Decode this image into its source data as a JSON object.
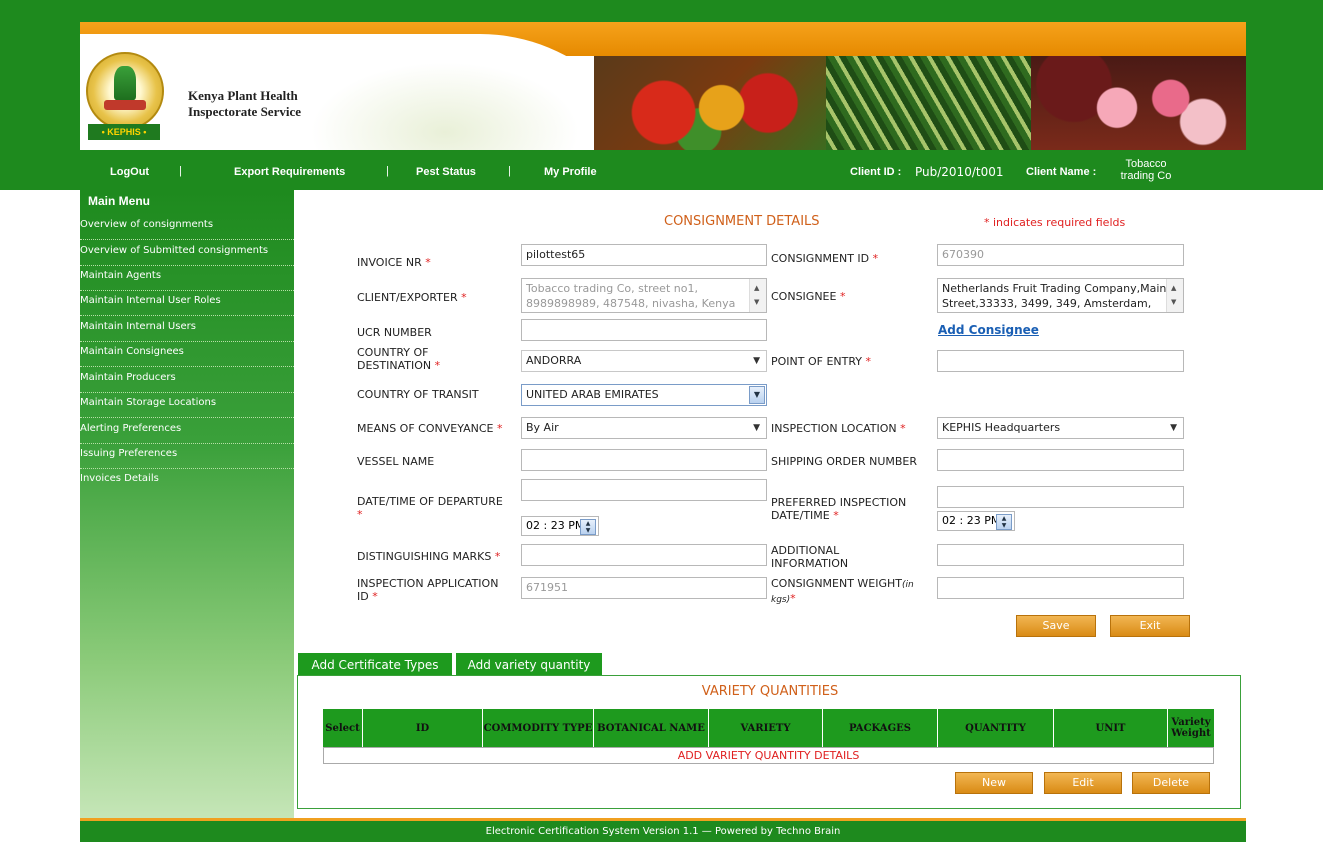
{
  "org": {
    "name_line1": "Kenya Plant Health",
    "name_line2": "Inspectorate Service",
    "logo_text": "• KEPHIS •"
  },
  "nav": {
    "items": [
      "LogOut",
      "Export Requirements",
      "Pest Status",
      "My Profile"
    ],
    "separator": "|",
    "client_id_label": "Client ID  :",
    "client_id_value": "Pub/2010/t001",
    "client_name_label": "Client Name  :",
    "client_name_value_line1": "Tobacco",
    "client_name_value_line2": "trading Co"
  },
  "sidebar": {
    "title": "Main Menu",
    "items": [
      "Overview of consignments",
      "Overview of Submitted consignments",
      "Maintain Agents",
      "Maintain Internal User Roles",
      "Maintain Internal Users",
      "Maintain Consignees",
      "Maintain Producers",
      "Maintain Storage Locations",
      "Alerting Preferences",
      "Issuing Preferences",
      "Invoices Details"
    ]
  },
  "form": {
    "title": "CONSIGNMENT DETAILS",
    "required_note": "* indicates required fields",
    "required_star": "*",
    "invoice_nr": {
      "label": "INVOICE NR",
      "value": "pilottest65"
    },
    "consignment_id": {
      "label": "CONSIGNMENT ID",
      "value": "670390"
    },
    "client_exporter": {
      "label": "CLIENT/EXPORTER",
      "value": "Tobacco trading Co, street no1, 8989898989, 487548, nivasha, Kenya"
    },
    "consignee": {
      "label": "CONSIGNEE",
      "value": "Netherlands Fruit Trading Company,Main Street,33333, 3499, 349, Amsterdam,"
    },
    "ucr_number": {
      "label": "UCR NUMBER",
      "value": ""
    },
    "add_consignee_link": "Add Consignee",
    "country_destination": {
      "label_line1": "COUNTRY OF",
      "label_line2": "DESTINATION",
      "value": "ANDORRA"
    },
    "point_of_entry": {
      "label": "POINT OF ENTRY",
      "value": ""
    },
    "country_transit": {
      "label": "COUNTRY OF TRANSIT",
      "value": "UNITED ARAB EMIRATES"
    },
    "means_conveyance": {
      "label": "MEANS OF CONVEYANCE",
      "value": "By Air"
    },
    "inspection_location": {
      "label": "INSPECTION LOCATION",
      "value": "KEPHIS Headquarters"
    },
    "vessel_name": {
      "label": "VESSEL NAME",
      "value": ""
    },
    "shipping_order": {
      "label": "SHIPPING ORDER NUMBER",
      "value": ""
    },
    "departure": {
      "label": "DATE/TIME OF DEPARTURE",
      "date": "",
      "time": "02 : 23 PM"
    },
    "preferred_inspection": {
      "label_line1": "PREFERRED INSPECTION",
      "label_line2": "DATE/TIME",
      "date": "",
      "time": "02 : 23 PM"
    },
    "distinguishing_marks": {
      "label": "DISTINGUISHING MARKS",
      "value": ""
    },
    "additional_info": {
      "label_line1": "ADDITIONAL",
      "label_line2": "INFORMATION",
      "value": ""
    },
    "inspection_app_id": {
      "label_line1": "INSPECTION APPLICATION",
      "label_line2": "ID",
      "value": "671951"
    },
    "consignment_weight": {
      "label_line1": "CONSIGNMENT WEIGHT",
      "label_unit": "(in",
      "label_line2": "kgs)",
      "value": ""
    },
    "save_label": "Save",
    "exit_label": "Exit"
  },
  "tabs": [
    "Add Certificate Types",
    "Add variety quantity"
  ],
  "variety": {
    "title": "VARIETY QUANTITIES",
    "columns": [
      "Select",
      "ID",
      "COMMODITY TYPE",
      "BOTANICAL NAME",
      "VARIETY",
      "PACKAGES",
      "QUANTITY",
      "UNIT",
      "Variety Weight"
    ],
    "empty_message": "ADD VARIETY QUANTITY DETAILS",
    "new_label": "New",
    "edit_label": "Edit",
    "delete_label": "Delete"
  },
  "footer": {
    "text": "Electronic Certification System Version 1.1 — Powered by Techno Brain"
  }
}
